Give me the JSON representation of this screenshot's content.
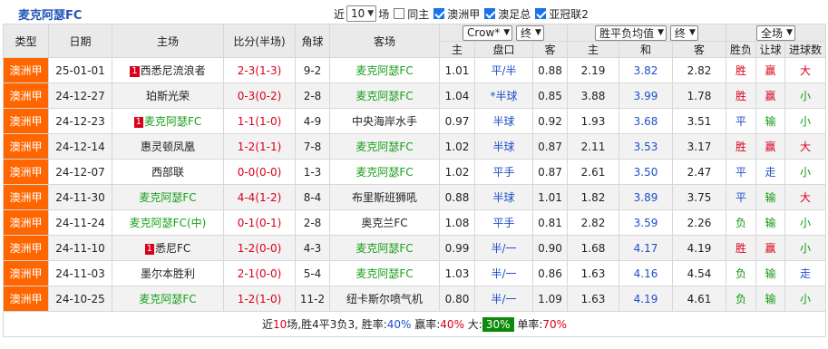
{
  "team_title": "麦克阿瑟FC",
  "filters": {
    "recent_label": "近",
    "recent_value": "10",
    "recent_unit": "场",
    "same_host_label": "同主",
    "league_1": "澳洲甲",
    "league_2": "澳足总",
    "league_3": "亚冠联2"
  },
  "headers": {
    "type": "类型",
    "date": "日期",
    "home": "主场",
    "score": "比分(半场)",
    "corner": "角球",
    "away": "客场",
    "company": "Crow*",
    "handicap_state": "终",
    "odds_mode": "胜平负均值",
    "odds_state": "终",
    "range": "全场",
    "h_home": "主",
    "h_line": "盘口",
    "h_away": "客",
    "o_home": "主",
    "o_draw": "和",
    "o_away": "客",
    "wdl": "胜负",
    "ah": "让球",
    "ou": "进球数"
  },
  "rows": [
    {
      "league": "澳洲甲",
      "date": "25-01-01",
      "home_rank": "1",
      "home": "西悉尼流浪者",
      "home_hl": false,
      "score": "2-3(1-3)",
      "corner": "9-2",
      "away": "麦克阿瑟FC",
      "away_hl": true,
      "h_home": "1.01",
      "h_line": "平/半",
      "h_away": "0.88",
      "o_home": "2.19",
      "o_draw": "3.82",
      "o_away": "2.82",
      "wdl": "胜",
      "ah": "赢",
      "ou": "大"
    },
    {
      "league": "澳洲甲",
      "date": "24-12-27",
      "home_rank": "",
      "home": "珀斯光荣",
      "home_hl": false,
      "score": "0-3(0-2)",
      "corner": "2-8",
      "away": "麦克阿瑟FC",
      "away_hl": true,
      "h_home": "1.04",
      "h_line": "*半球",
      "h_away": "0.85",
      "o_home": "3.88",
      "o_draw": "3.99",
      "o_away": "1.78",
      "wdl": "胜",
      "ah": "赢",
      "ou": "小"
    },
    {
      "league": "澳洲甲",
      "date": "24-12-23",
      "home_rank": "1",
      "home": "麦克阿瑟FC",
      "home_hl": true,
      "score": "1-1(1-0)",
      "corner": "4-9",
      "away": "中央海岸水手",
      "away_hl": false,
      "h_home": "0.97",
      "h_line": "半球",
      "h_away": "0.92",
      "o_home": "1.93",
      "o_draw": "3.68",
      "o_away": "3.51",
      "wdl": "平",
      "ah": "输",
      "ou": "小"
    },
    {
      "league": "澳洲甲",
      "date": "24-12-14",
      "home_rank": "",
      "home": "惠灵顿凤凰",
      "home_hl": false,
      "score": "1-2(1-1)",
      "corner": "7-8",
      "away": "麦克阿瑟FC",
      "away_hl": true,
      "h_home": "1.02",
      "h_line": "半球",
      "h_away": "0.87",
      "o_home": "2.11",
      "o_draw": "3.53",
      "o_away": "3.17",
      "wdl": "胜",
      "ah": "赢",
      "ou": "大"
    },
    {
      "league": "澳洲甲",
      "date": "24-12-07",
      "home_rank": "",
      "home": "西部联",
      "home_hl": false,
      "score": "0-0(0-0)",
      "corner": "1-3",
      "away": "麦克阿瑟FC",
      "away_hl": true,
      "h_home": "1.02",
      "h_line": "平手",
      "h_away": "0.87",
      "o_home": "2.61",
      "o_draw": "3.50",
      "o_away": "2.47",
      "wdl": "平",
      "ah": "走",
      "ou": "小"
    },
    {
      "league": "澳洲甲",
      "date": "24-11-30",
      "home_rank": "",
      "home": "麦克阿瑟FC",
      "home_hl": true,
      "score": "4-4(1-2)",
      "corner": "8-4",
      "away": "布里斯班狮吼",
      "away_hl": false,
      "h_home": "0.88",
      "h_line": "半球",
      "h_away": "1.01",
      "o_home": "1.82",
      "o_draw": "3.89",
      "o_away": "3.75",
      "wdl": "平",
      "ah": "输",
      "ou": "大"
    },
    {
      "league": "澳洲甲",
      "date": "24-11-24",
      "home_rank": "",
      "home": "麦克阿瑟FC(中)",
      "home_hl": true,
      "score": "0-1(0-1)",
      "corner": "2-8",
      "away": "奥克兰FC",
      "away_hl": false,
      "h_home": "1.08",
      "h_line": "平手",
      "h_away": "0.81",
      "o_home": "2.82",
      "o_draw": "3.59",
      "o_away": "2.26",
      "wdl": "负",
      "ah": "输",
      "ou": "小"
    },
    {
      "league": "澳洲甲",
      "date": "24-11-10",
      "home_rank": "1",
      "home": "悉尼FC",
      "home_hl": false,
      "score": "1-2(0-0)",
      "corner": "4-3",
      "away": "麦克阿瑟FC",
      "away_hl": true,
      "h_home": "0.99",
      "h_line": "半/一",
      "h_away": "0.90",
      "o_home": "1.68",
      "o_draw": "4.17",
      "o_away": "4.19",
      "wdl": "胜",
      "ah": "赢",
      "ou": "小"
    },
    {
      "league": "澳洲甲",
      "date": "24-11-03",
      "home_rank": "",
      "home": "墨尔本胜利",
      "home_hl": false,
      "score": "2-1(0-0)",
      "corner": "5-4",
      "away": "麦克阿瑟FC",
      "away_hl": true,
      "h_home": "1.03",
      "h_line": "半/一",
      "h_away": "0.86",
      "o_home": "1.63",
      "o_draw": "4.16",
      "o_away": "4.54",
      "wdl": "负",
      "ah": "输",
      "ou": "走"
    },
    {
      "league": "澳洲甲",
      "date": "24-10-25",
      "home_rank": "",
      "home": "麦克阿瑟FC",
      "home_hl": true,
      "score": "1-2(1-0)",
      "corner": "11-2",
      "away": "纽卡斯尔喷气机",
      "away_hl": false,
      "h_home": "0.80",
      "h_line": "半/一",
      "h_away": "1.09",
      "o_home": "1.63",
      "o_draw": "4.19",
      "o_away": "4.61",
      "wdl": "负",
      "ah": "输",
      "ou": "小"
    }
  ],
  "summary": {
    "p1": "近",
    "n_matches": "10",
    "p2": "场,胜",
    "wins": "4",
    "p3": "平",
    "draws": "3",
    "p4": "负",
    "losses": "3",
    "p5": ", 胜率:",
    "win_rate": "40%",
    "p6": " 赢率:",
    "ah_rate": "40%",
    "p7": " 大:",
    "over_rate": "30%",
    "p8": " 单率:",
    "odd_rate": "70%"
  },
  "colors": {
    "league_bg": "#ff6600",
    "team_green": "#1aa01a",
    "win": "#d9001b",
    "draw": "#1e50c8",
    "loss": "#119911",
    "highlight": "#0b8a0b"
  }
}
